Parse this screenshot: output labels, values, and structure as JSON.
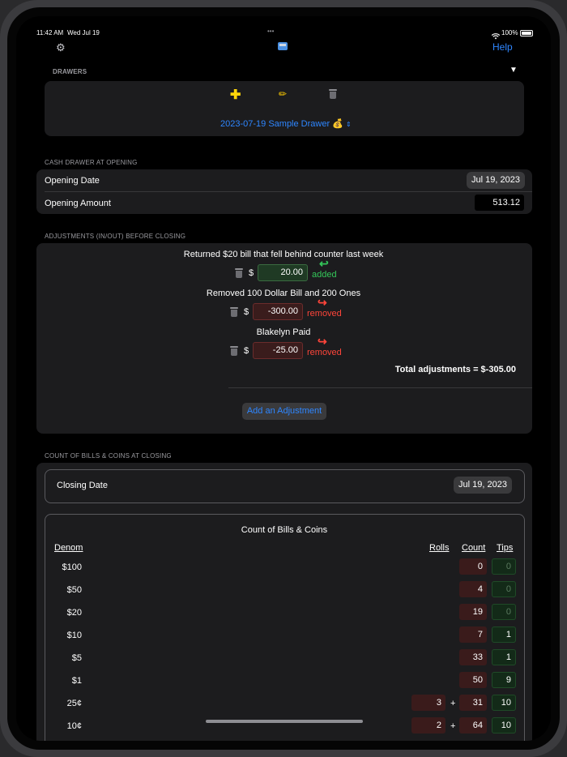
{
  "status_bar": {
    "time": "11:42 AM",
    "date": "Wed Jul 19",
    "battery": "100%"
  },
  "toolbar": {
    "help_label": "Help",
    "more_dots": "•••"
  },
  "drawers": {
    "header": "DRAWERS",
    "collapse_glyph": "▼",
    "selected_drawer": "2023-07-19 Sample Drawer 💰"
  },
  "opening": {
    "section_label": "CASH DRAWER AT OPENING",
    "date_label": "Opening Date",
    "date_value": "Jul 19, 2023",
    "amount_label": "Opening Amount",
    "amount_value": "513.12"
  },
  "adjustments": {
    "section_label": "ADJUSTMENTS (IN/OUT) BEFORE CLOSING",
    "items": [
      {
        "description": "Returned $20 bill that fell behind counter last week",
        "currency": "$",
        "amount": "20.00",
        "status": "added",
        "direction": "in"
      },
      {
        "description": "Removed 100 Dollar Bill and 200 Ones",
        "currency": "$",
        "amount": "-300.00",
        "status": "removed",
        "direction": "out"
      },
      {
        "description": "Blakelyn Paid",
        "currency": "$",
        "amount": "-25.00",
        "status": "removed",
        "direction": "out"
      }
    ],
    "total_text": "Total adjustments = $-305.00",
    "add_button_label": "Add an Adjustment"
  },
  "closing": {
    "section_label": "COUNT OF BILLS & COINS AT CLOSING",
    "date_label": "Closing Date",
    "date_value": "Jul 19, 2023",
    "count_title": "Count of Bills & Coins",
    "columns": {
      "denom": "Denom",
      "rolls": "Rolls",
      "count": "Count",
      "tips": "Tips"
    },
    "plus_glyph": "+",
    "rows": [
      {
        "denom": "$100",
        "rolls": "",
        "count": "0",
        "tips": "0"
      },
      {
        "denom": "$50",
        "rolls": "",
        "count": "4",
        "tips": "0"
      },
      {
        "denom": "$20",
        "rolls": "",
        "count": "19",
        "tips": "0"
      },
      {
        "denom": "$10",
        "rolls": "",
        "count": "7",
        "tips": "1"
      },
      {
        "denom": "$5",
        "rolls": "",
        "count": "33",
        "tips": "1"
      },
      {
        "denom": "$1",
        "rolls": "",
        "count": "50",
        "tips": "9"
      },
      {
        "denom": "25¢",
        "rolls": "3",
        "count": "31",
        "tips": "10"
      },
      {
        "denom": "10¢",
        "rolls": "2",
        "count": "64",
        "tips": "10"
      }
    ]
  },
  "colors": {
    "accent": "#2e86ff",
    "added": "#34c759",
    "removed": "#ff453a",
    "background": "#000000",
    "card": "#1c1c1e"
  }
}
